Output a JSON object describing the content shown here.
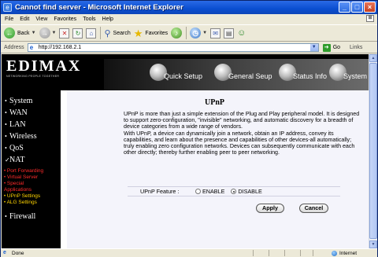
{
  "window": {
    "title": "Cannot find server - Microsoft Internet Explorer"
  },
  "menu": {
    "items": [
      "File",
      "Edit",
      "View",
      "Favorites",
      "Tools",
      "Help"
    ]
  },
  "toolbar": {
    "back_label": "Back",
    "search_label": "Search",
    "favorites_label": "Favorites"
  },
  "address": {
    "label": "Address",
    "url": "http://192.168.2.1",
    "go_label": "Go",
    "links_label": "Links"
  },
  "banner": {
    "logo": "EDIMAX",
    "tagline": "NETWORKING PEOPLE TOGETHER",
    "tabs": [
      "Quick Setup",
      "General Seup",
      "Status Info",
      "System Tools"
    ]
  },
  "nav": {
    "items": [
      "System",
      "WAN",
      "LAN",
      "Wireless",
      "QoS",
      "NAT",
      "Firewall"
    ],
    "nat_sub": [
      "Port Forwarding",
      "Virtual Server",
      "Special",
      "Applications",
      "UPnP Settings",
      "ALG Settings"
    ]
  },
  "main": {
    "heading": "UPnP",
    "paragraph1": "UPnP is more than just a simple extension of the Plug and Play peripheral model. It is designed to support zero-configuration, \"invisible\" networking, and automatic discovery for a breadth of device categories from a wide range of vendors.",
    "paragraph2": "With UPnP, a device can dynamically join a network, obtain an IP address, convey its capabilities, and learn about the presence and capabilities of other devices-all automatically; truly enabling zero configuration networks. Devices can subsequently communicate with each other directly; thereby further enabling peer to peer networking.",
    "feature_label": "UPnP Feature :",
    "option_enable": "ENABLE",
    "option_disable": "DISABLE",
    "selected": "DISABLE",
    "apply_label": "Apply",
    "cancel_label": "Cancel"
  },
  "status": {
    "text": "Done",
    "zone": "Internet"
  }
}
